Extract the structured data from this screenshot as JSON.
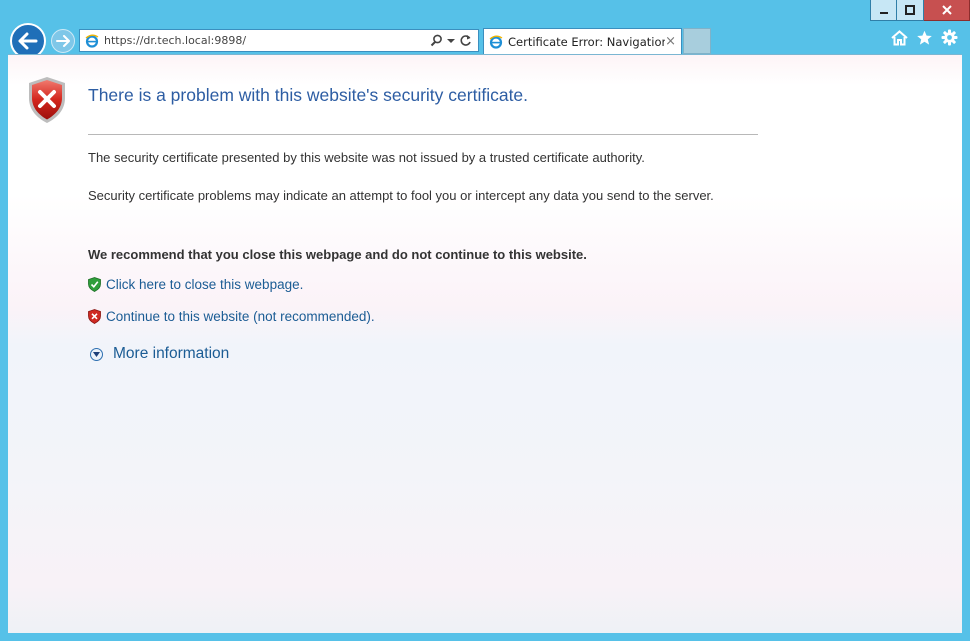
{
  "browser": {
    "address_url": "https://dr.tech.local:9898/",
    "tab_title": "Certificate Error: Navigation...",
    "tab_close_glyph": "×"
  },
  "page": {
    "heading": "There is a problem with this website's security certificate.",
    "paragraph1": "The security certificate presented by this website was not issued by a trusted certificate authority.",
    "paragraph2": "Security certificate problems may indicate an attempt to fool you or intercept any data you send to the server.",
    "recommendation": "We recommend that you close this webpage and do not continue to this website.",
    "close_link": "Click here to close this webpage.",
    "continue_link": "Continue to this website (not recommended).",
    "more_info": "More information"
  },
  "colors": {
    "frame": "#56c1e8",
    "heading": "#2d5da3",
    "link": "#1b5c94",
    "close_button": "#c75050"
  },
  "icons": [
    "back-arrow-icon",
    "forward-arrow-icon",
    "ie-logo-icon",
    "search-icon",
    "dropdown-icon",
    "refresh-icon",
    "home-icon",
    "favorites-star-icon",
    "gear-icon",
    "error-shield-icon",
    "green-shield-icon",
    "red-shield-icon",
    "expand-chevron-icon",
    "minimize-icon",
    "maximize-icon",
    "close-icon"
  ]
}
